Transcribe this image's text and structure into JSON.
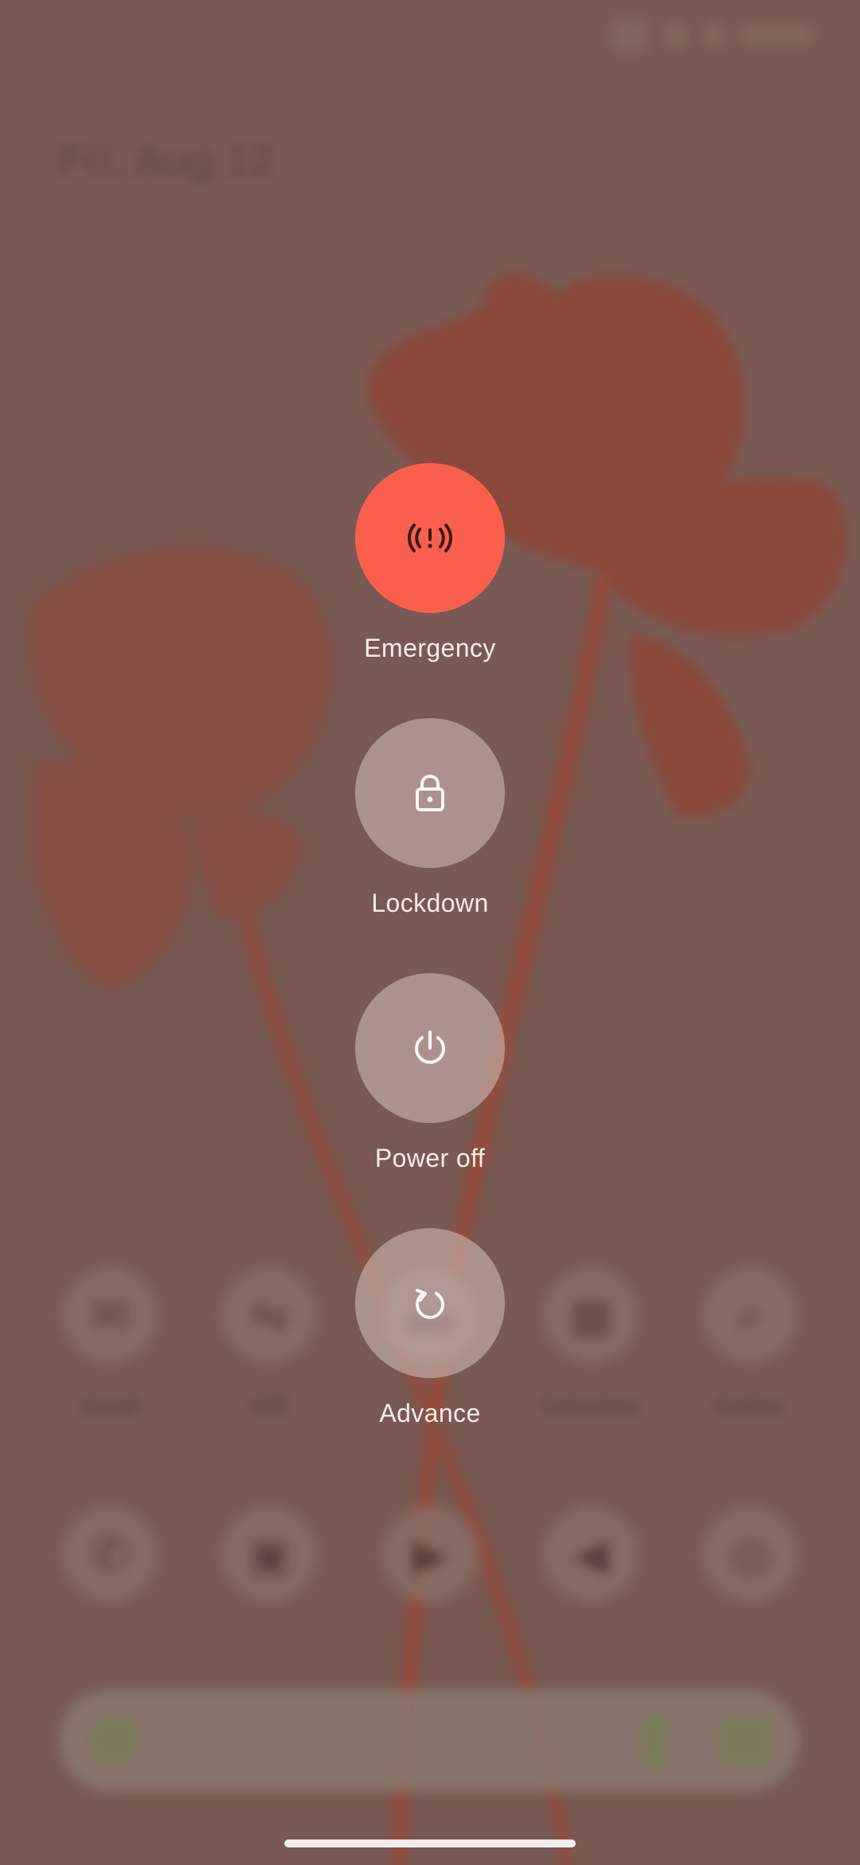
{
  "status_bar": {
    "time": "",
    "icons": [
      "wifi-icon",
      "signal-icon",
      "battery-icon"
    ]
  },
  "home": {
    "date": "Fri, Aug 12",
    "apps_row_1": [
      {
        "icon": "gmail-icon",
        "label": "Gmail"
      },
      {
        "icon": "wifi-app-icon",
        "label": "Wifi"
      },
      {
        "icon": "app-icon",
        "label": ""
      },
      {
        "icon": "calculator-icon",
        "label": "Calculator"
      },
      {
        "icon": "gallery-icon",
        "label": "Gallery"
      }
    ],
    "apps_row_2": [
      {
        "icon": "phone-icon",
        "label": ""
      },
      {
        "icon": "messages-icon",
        "label": ""
      },
      {
        "icon": "play-store-icon",
        "label": ""
      },
      {
        "icon": "telegram-icon",
        "label": ""
      },
      {
        "icon": "chrome-icon",
        "label": ""
      }
    ],
    "search_bar": {
      "icons": [
        "google-icon",
        "mic-icon",
        "lens-icon"
      ]
    }
  },
  "power_menu": {
    "actions": [
      {
        "name": "emergency",
        "label": "Emergency",
        "icon": "emergency-broadcast-icon",
        "color": "#fa5f4e"
      },
      {
        "name": "lockdown",
        "label": "Lockdown",
        "icon": "lock-icon",
        "color": "#b8a4a0"
      },
      {
        "name": "power-off",
        "label": "Power off",
        "icon": "power-icon",
        "color": "#b8a4a0"
      },
      {
        "name": "restart",
        "label": "Advance",
        "icon": "restart-icon",
        "color": "#b8a4a0"
      }
    ]
  },
  "colors": {
    "background": "#795a54",
    "emergency": "#fa5f4e",
    "label_text": "#f4ece8"
  }
}
